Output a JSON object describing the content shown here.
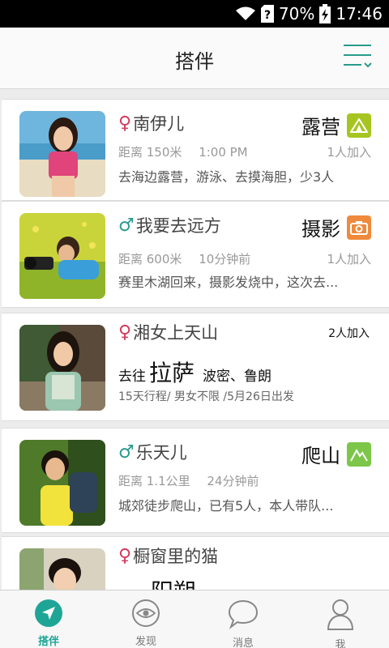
{
  "status_bar": {
    "battery": "70%",
    "time": "17:46"
  },
  "header": {
    "title": "搭伴"
  },
  "cards": [
    {
      "gender": "♀",
      "name": "南伊儿",
      "activity": "露营",
      "distance": "距离 150米",
      "time": "1:00 PM",
      "joined": "1人加入",
      "desc": "去海边露营，游泳、去摸海胆，少3人"
    },
    {
      "gender": "♂",
      "name": "我要去远方",
      "activity": "摄影",
      "distance": "距离 600米",
      "time": "10分钟前",
      "joined": "1人加入",
      "desc": "赛里木湖回来，摄影发烧中，这次去..."
    },
    {
      "gender": "♀",
      "name": "湘女上天山",
      "joined": "2人加入",
      "go": "去往",
      "place": "拉萨",
      "via": "波密、鲁朗",
      "details": "15天行程/  男女不限  /5月26日出发"
    },
    {
      "gender": "♂",
      "name": "乐天儿",
      "activity": "爬山",
      "distance": "距离 1.1公里",
      "time": "24分钟前",
      "desc": "城郊徒步爬山，已有5人，本人带队..."
    },
    {
      "gender": "♀",
      "name": "橱窗里的猫",
      "place": "阳朔"
    }
  ],
  "tabs": [
    {
      "label": "搭伴",
      "icon": "location-arrow-icon",
      "active": true
    },
    {
      "label": "发现",
      "icon": "eye-icon"
    },
    {
      "label": "消息",
      "icon": "chat-bubble-icon"
    },
    {
      "label": "我",
      "icon": "user-icon"
    }
  ],
  "colors": {
    "accent": "#1fa596",
    "female": "#d23a5a",
    "male": "#2a9a8c",
    "camp": "#a7c520",
    "photo": "#ef8a3c",
    "hike": "#7cc64a"
  }
}
